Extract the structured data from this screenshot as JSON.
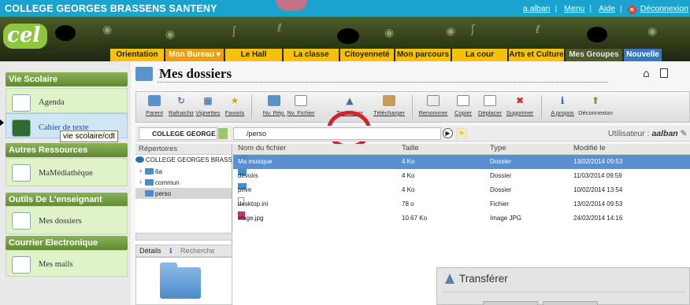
{
  "header": {
    "school_name": "COLLEGE GEORGES BRASSENS SANTENY",
    "user_link": "a.alban",
    "menu_link": "Menu",
    "help_link": "Aide",
    "logout_link": "Déconnexion"
  },
  "logo": {
    "text": "cel"
  },
  "nav": {
    "tabs": [
      {
        "label": "Orientation"
      },
      {
        "label": "Mon Bureau"
      },
      {
        "label": "Le Hall"
      },
      {
        "label": "La classe"
      },
      {
        "label": "Citoyenneté"
      },
      {
        "label": "Mon parcours"
      },
      {
        "label": "La cour"
      },
      {
        "label": "Arts et Culture"
      },
      {
        "label": "Mes Groupes"
      },
      {
        "label": "Nouvelle"
      }
    ]
  },
  "sidebar": {
    "sections": [
      {
        "title": "Vie Scolaire",
        "items": [
          "Agenda",
          "Cahier de texte"
        ]
      },
      {
        "title": "Autres Ressources",
        "items": [
          "MaMédiathèque"
        ]
      },
      {
        "title": "Outils De L'enseignant",
        "items": [
          "Mes dossiers"
        ]
      },
      {
        "title": "Courrier Electronique",
        "items": [
          "Mes mails"
        ]
      }
    ],
    "tooltip": "vie scolaire/cdt"
  },
  "main": {
    "title": "Mes dossiers",
    "toolbar": [
      "Parent",
      "Rafraichir",
      "Vignettes",
      "Favoris",
      "Nv. Rép.",
      "Nv. Fichier",
      "Transférer",
      "Télécharger",
      "Renommer",
      "Copier",
      "Déplacer",
      "Supprimer",
      "A propos",
      "Déconnexion"
    ],
    "site_select": "COLLEGE GEORGE",
    "path": "/perso",
    "user_label": "Utilisateur :",
    "user_name": "aalban"
  },
  "directories": {
    "header": "Répertoires",
    "root": "COLLEGE GEORGES BRASSENS",
    "children": [
      "6a",
      "commun",
      "perso"
    ]
  },
  "details": {
    "tab1": "Détails",
    "tab2": "Recherche"
  },
  "files": {
    "columns": [
      "Nom du fichier",
      "Taille",
      "Type",
      "Modifié le"
    ],
    "rows": [
      {
        "name": "Ma musique",
        "size": "4 Ko",
        "type": "Dossier",
        "date": "13/02/2014 09:53"
      },
      {
        "name": "devoirs",
        "size": "4 Ko",
        "type": "Dossier",
        "date": "11/03/2014 09:59"
      },
      {
        "name": "prive",
        "size": "4 Ko",
        "type": "Dossier",
        "date": "10/02/2014 13:54"
      },
      {
        "name": "desktop.ini",
        "size": "78 o",
        "type": "Fichier",
        "date": "13/02/2014 09:53"
      },
      {
        "name": "stage.jpg",
        "size": "10.67 Ko",
        "type": "Image JPG",
        "date": "24/03/2014 14:16"
      }
    ]
  },
  "dialog": {
    "title": "Transférer"
  },
  "colors": {
    "topbar": "#1aa3cf",
    "tab": "#f4c20d",
    "sidebar_head": "#6e9a3c",
    "selection": "#5b8fd0",
    "highlight": "#d2232a"
  }
}
